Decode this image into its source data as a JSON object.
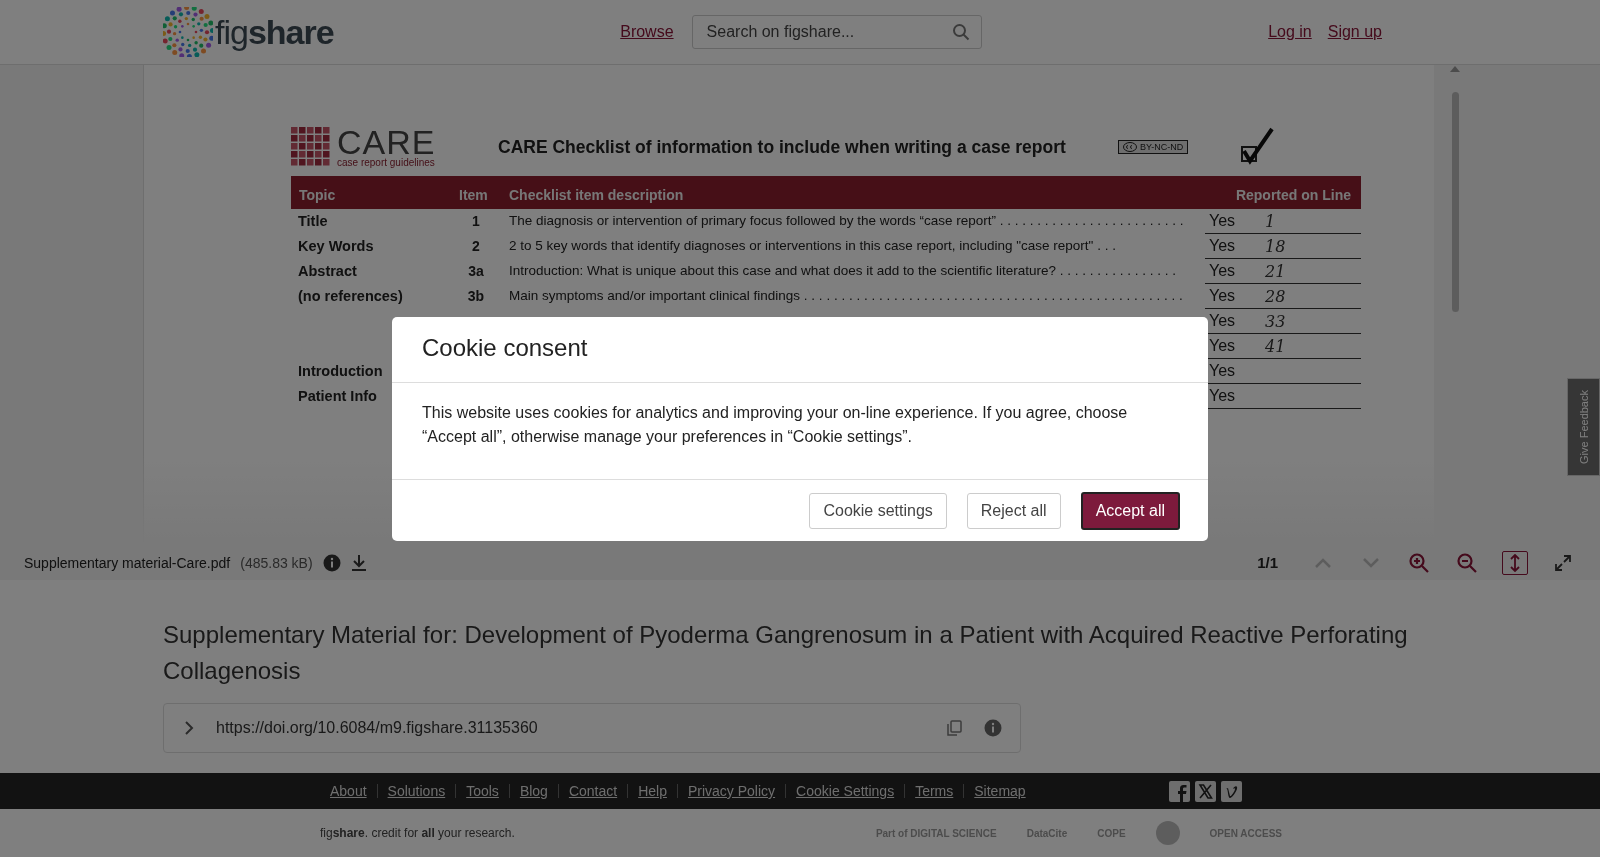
{
  "header": {
    "logo": "fig**share**",
    "browse_link": "Browse",
    "search": {
      "placeholder": "Search on figshare..."
    },
    "login_link": "Log in",
    "signup_link": "Sign up"
  },
  "viewer": {
    "document": {
      "brand": "CARE",
      "brand_tagline": "case report guidelines",
      "title": "CARE Checklist of information to include when writing a case report",
      "license": "BY-NC-ND",
      "columns": [
        "Topic",
        "Item",
        "Checklist item description",
        "Reported on Line"
      ],
      "rows": [
        {
          "topic": "Title",
          "item": "1",
          "description": "The diagnosis or intervention of primary focus followed by the words “case report” . . . . . . . . . . . . . . . . . . . . . . . . .",
          "answer": "Yes",
          "line": "1"
        },
        {
          "topic": "Key Words",
          "item": "2",
          "description": "2 to 5 key words that identify diagnoses or interventions in this case report, including \"case report\" . . .",
          "answer": "Yes",
          "line": "18"
        },
        {
          "topic": "Abstract",
          "item": "3a",
          "description": "Introduction: What is unique about this case and what does it add to the scientific literature? . . . . . . . . . . . . . . . .",
          "answer": "Yes",
          "line": "21"
        },
        {
          "topic": "(no references)",
          "item": "3b",
          "description": "Main symptoms and/or important clinical findings . . . . . . . . . . . . . . . . . . . . . . . . . . . . . . . . . . . . . . . . . . . . . . . . . . .",
          "answer": "Yes",
          "line": "28"
        },
        {
          "answer": "Yes",
          "line": "33"
        },
        {
          "answer": "Yes",
          "line": "41"
        },
        {
          "topic": "Introduction",
          "answer": "Yes"
        },
        {
          "topic": "Patient Info",
          "answer": "Yes"
        }
      ]
    },
    "file_name": "Supplementary material-Care.pdf",
    "file_size": "(485.83 kB)",
    "page": "1/1",
    "tools": [
      {
        "kind": "up",
        "disabled": true
      },
      {
        "kind": "down",
        "disabled": true
      },
      {
        "kind": "zoom-in",
        "disabled": false
      },
      {
        "kind": "zoom-out",
        "disabled": false
      },
      {
        "kind": "fit",
        "selected": true
      },
      {
        "kind": "fullscreen",
        "disabled": false
      }
    ],
    "feedback_tab": "Give Feedback"
  },
  "record": {
    "title": "Supplementary Material for: Development of Pyoderma Gangrenosum in a Patient with Acquired Reactive Perforating Collagenosis",
    "doi": "https://doi.org/10.6084/m9.figshare.31135360"
  },
  "footer": {
    "links": [
      "About",
      "Solutions",
      "Tools",
      "Blog",
      "Contact",
      "Help",
      "Privacy Policy",
      "Cookie Settings",
      "Terms",
      "Sitemap"
    ],
    "tagline": "fig**share**. credit for **all** your research.",
    "partners": [
      {
        "kind": "text",
        "label": "Part of DIGITAL SCIENCE"
      },
      {
        "kind": "text",
        "label": "DataCite"
      },
      {
        "kind": "text",
        "label": "COPE"
      },
      {
        "kind": "seal"
      },
      {
        "kind": "text",
        "label": "OPEN ACCESS"
      }
    ]
  },
  "cookie_dialog": {
    "title": "Cookie consent",
    "text": "This website uses cookies for analytics and improving your on-line experience. If you agree, choose “Accept all”, otherwise manage your preferences in “Cookie settings”.",
    "buttons": [
      {
        "label": "Cookie settings",
        "kind": "secondary"
      },
      {
        "label": "Reject all",
        "kind": "secondary"
      },
      {
        "label": "Accept all",
        "kind": "primary"
      }
    ]
  }
}
